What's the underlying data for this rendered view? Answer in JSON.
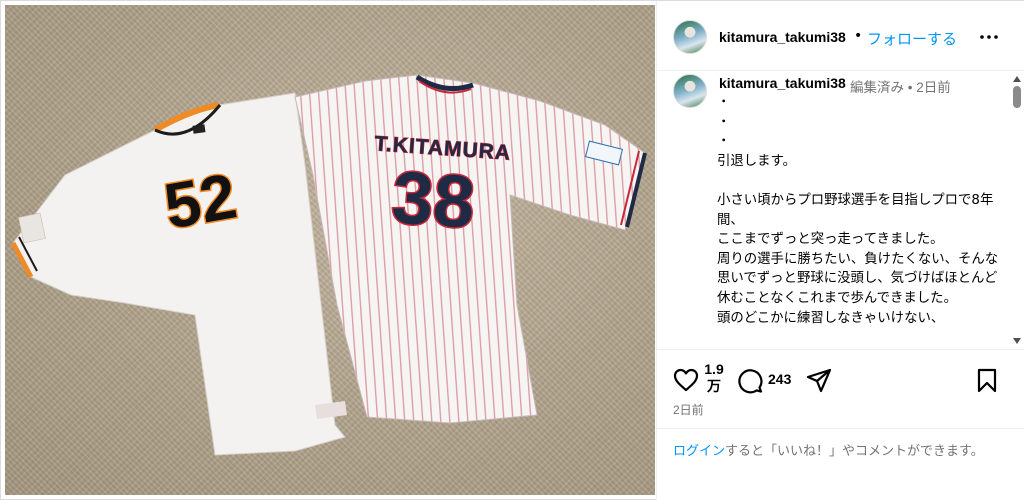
{
  "post": {
    "username": "kitamura_takumi38",
    "follow_label": "フォローする",
    "separator": "•",
    "edited_label": "編集済み",
    "meta_dot": "•",
    "age": "2日前",
    "caption": "・\n・\n・\n引退します。\n\n小さい頃からプロ野球選手を目指しプロで8年間、\nここまでずっと突っ走ってきました。\n周りの選手に勝ちたい、負けたくない、そんな思いでずっと野球に没頭し、気づけばほとんど休むことなくこれまで歩んできました。\n頭のどこかに練習しなきゃいけない、"
  },
  "photo": {
    "left_jersey_number": "52",
    "right_jersey_name": "T.KITAMURA",
    "right_jersey_number": "38"
  },
  "actions": {
    "like_count": "1.9万",
    "like_count_line1": "1.9",
    "like_count_line2": "万",
    "comment_count": "243",
    "posted": "2日前"
  },
  "login": {
    "link_label": "ログイン",
    "rest": "すると「いいね！」やコメントができます。"
  },
  "icons": {
    "more": "more-horizontal-icon",
    "like": "heart-icon",
    "comment": "comment-bubble-icon",
    "share": "paper-plane-icon",
    "save": "bookmark-icon"
  },
  "colors": {
    "link": "#0095f6",
    "secondary_text": "#737373",
    "border": "#efefef",
    "giants_orange": "#f08a24",
    "swallows_navy": "#1f2a44",
    "swallows_red": "#c8283a"
  }
}
